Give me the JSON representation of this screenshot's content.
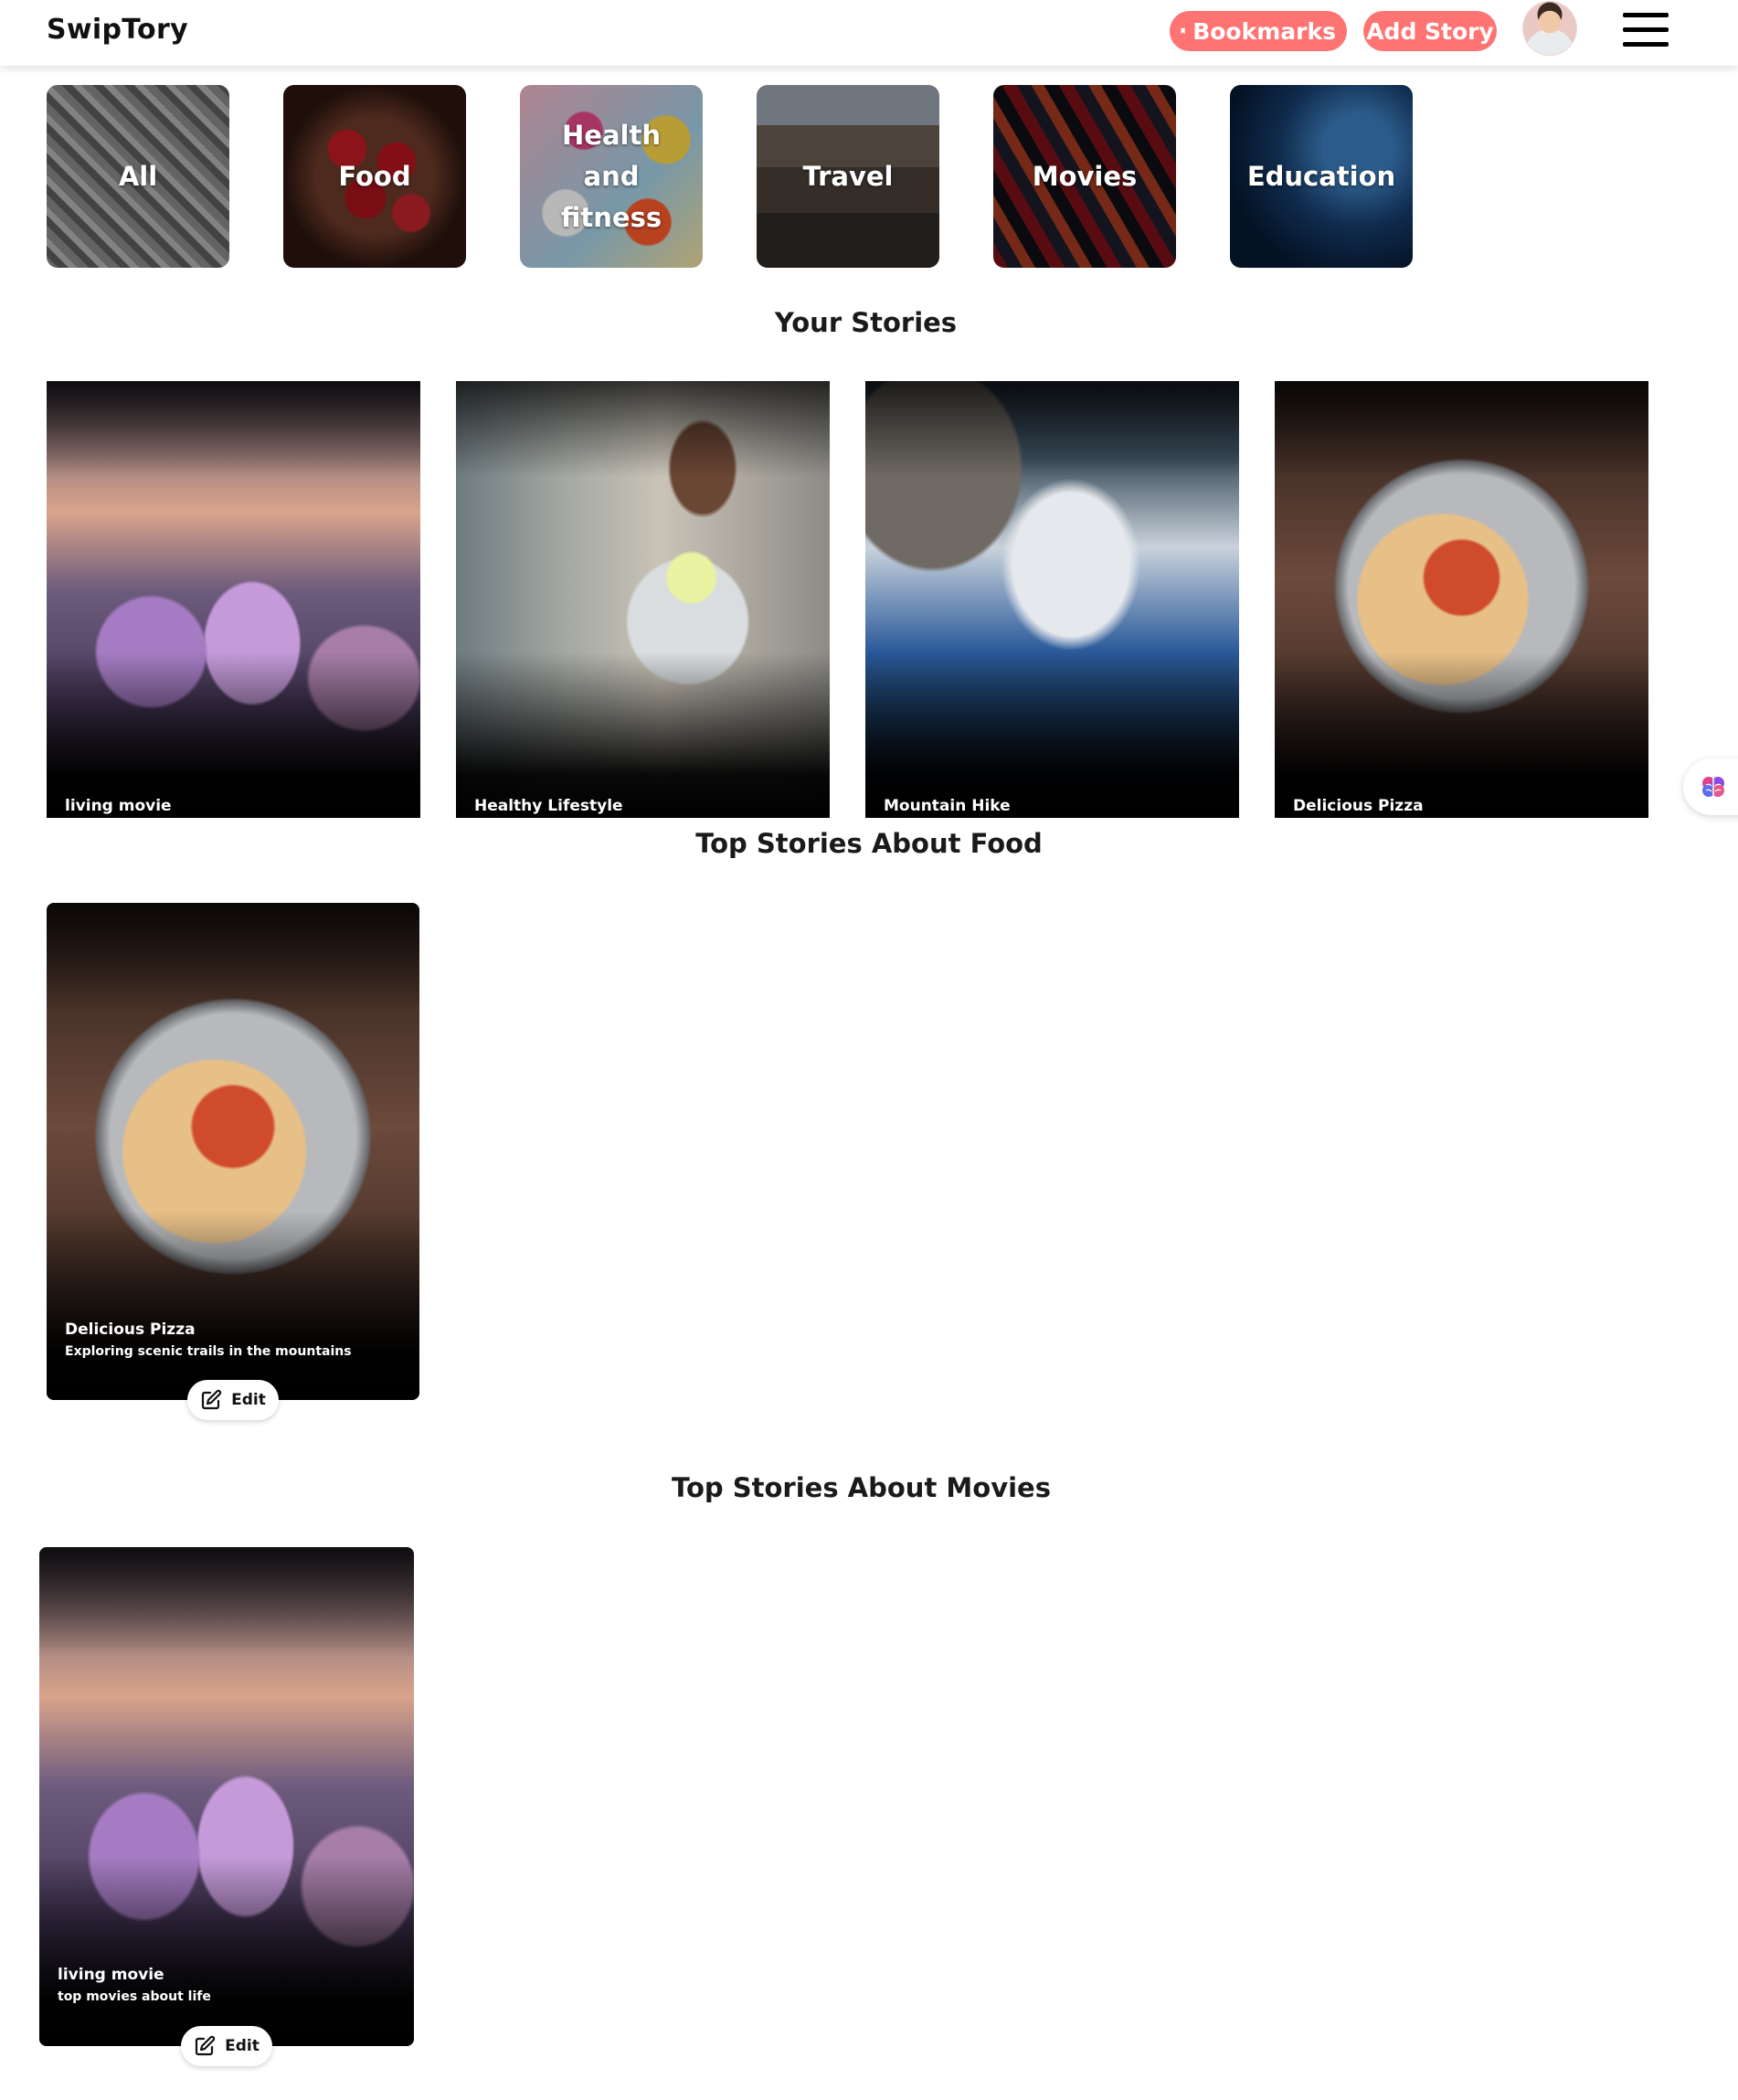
{
  "header": {
    "logo": "SwipTory",
    "bookmarks_label": "Bookmarks",
    "add_story_label": "Add Story",
    "accent_color": "#ff7373",
    "avatar_icon": "user-avatar",
    "menu_icon": "hamburger-menu-icon"
  },
  "categories": [
    {
      "label": "All"
    },
    {
      "label": "Food"
    },
    {
      "label": "Health and fitness"
    },
    {
      "label": "Travel"
    },
    {
      "label": "Movies"
    },
    {
      "label": "Education"
    }
  ],
  "sections": {
    "your_stories": {
      "title": "Your Stories",
      "stories": [
        {
          "title": "living movie"
        },
        {
          "title": "Healthy Lifestyle"
        },
        {
          "title": "Mountain Hike"
        },
        {
          "title": "Delicious Pizza"
        }
      ]
    },
    "food": {
      "title": "Top Stories About Food",
      "stories": [
        {
          "title": "Delicious Pizza",
          "description": "Exploring scenic trails in the mountains",
          "edit_label": "Edit"
        }
      ]
    },
    "movies": {
      "title": "Top Stories About Movies",
      "stories": [
        {
          "title": "living movie",
          "description": "top movies about life",
          "edit_label": "Edit"
        }
      ]
    }
  }
}
